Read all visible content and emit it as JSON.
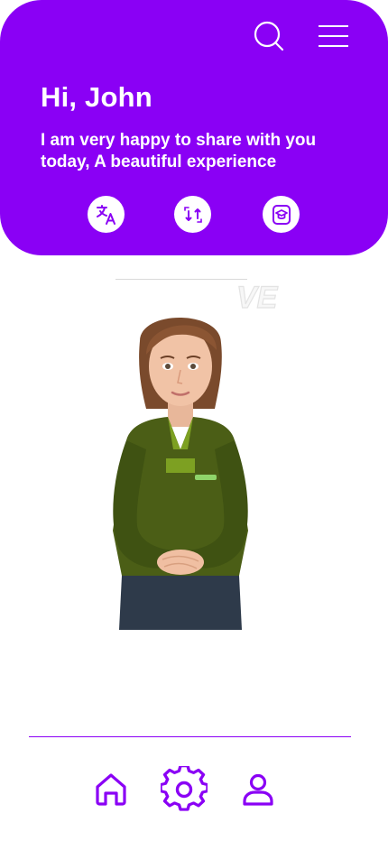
{
  "header": {
    "greeting": "Hi, John",
    "subtitle": "I am very happy to share with you today, A beautiful experience",
    "icons": {
      "search": "search-icon",
      "menu": "menu-icon"
    },
    "actions": [
      "translate-icon",
      "convert-icon",
      "learn-icon"
    ]
  },
  "watermark": {
    "text": "VE"
  },
  "nav": {
    "items": [
      "home-icon",
      "settings-icon",
      "profile-icon"
    ]
  },
  "colors": {
    "accent": "#8a00f5",
    "background": "#ffffff",
    "header_text": "#ffffff"
  }
}
